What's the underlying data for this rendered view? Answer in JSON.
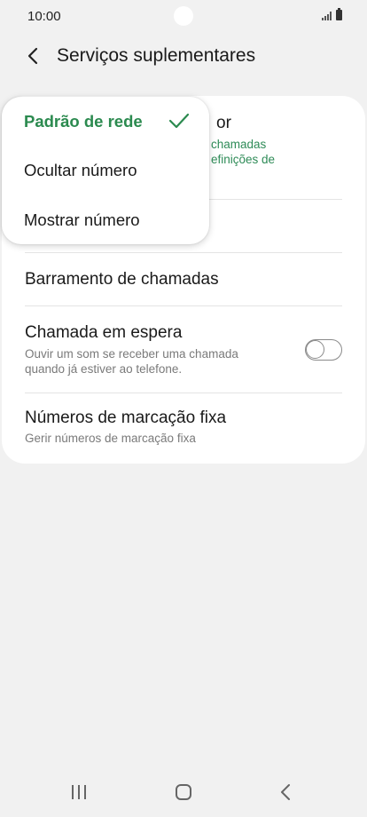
{
  "status": {
    "time": "10:00"
  },
  "header": {
    "title": "Serviços suplementares"
  },
  "rows": {
    "caller_id_title_partial": "or",
    "caller_id_sub_partial": "chamadas\nefinições de",
    "call_barring": {
      "title": "Barramento de chamadas"
    },
    "call_waiting": {
      "title": "Chamada em espera",
      "subtitle": "Ouvir um som se receber uma chamada quando já estiver ao telefone.",
      "enabled": false
    },
    "fixed_dialing": {
      "title": "Números de marcação fixa",
      "subtitle": "Gerir números de marcação fixa"
    }
  },
  "popup": {
    "items": [
      {
        "label": "Padrão de rede",
        "selected": true
      },
      {
        "label": "Ocultar número",
        "selected": false
      },
      {
        "label": "Mostrar número",
        "selected": false
      }
    ]
  },
  "colors": {
    "accent": "#2b8a4f",
    "background": "#f1f1f1",
    "card": "#ffffff"
  }
}
